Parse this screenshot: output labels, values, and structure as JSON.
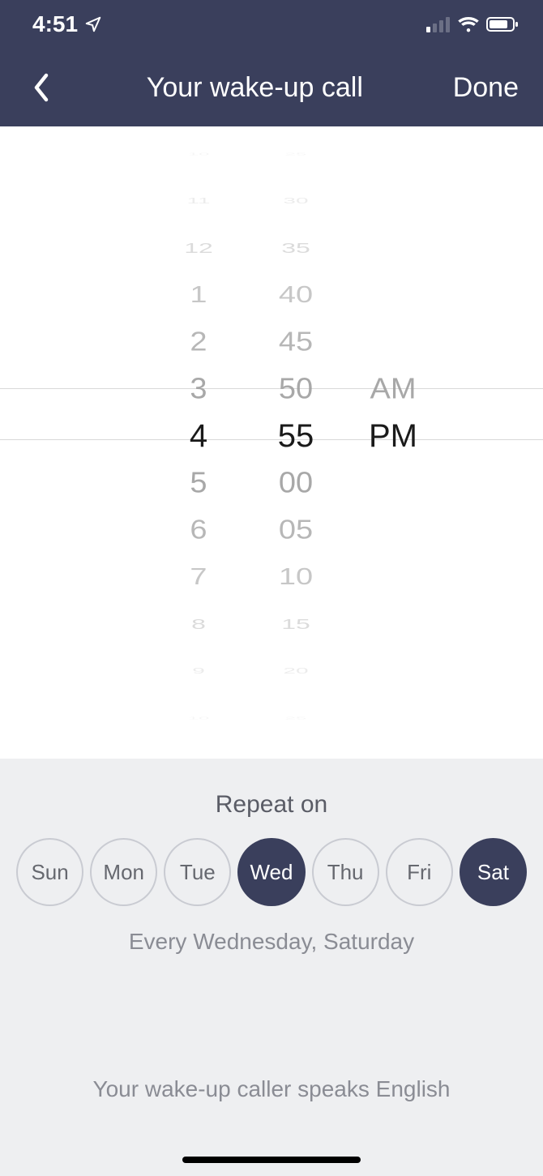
{
  "status": {
    "time": "4:51"
  },
  "nav": {
    "title": "Your wake-up call",
    "done": "Done"
  },
  "picker": {
    "hours": [
      "10",
      "11",
      "12",
      "1",
      "2",
      "3",
      "4",
      "5",
      "6",
      "7",
      "8",
      "9",
      "10"
    ],
    "minutes": [
      "25",
      "30",
      "35",
      "40",
      "45",
      "50",
      "55",
      "00",
      "05",
      "10",
      "15",
      "20",
      "25"
    ],
    "period_top": "AM",
    "period_sel": "PM",
    "selected_hour": "4",
    "selected_minute": "55",
    "selected_period": "PM"
  },
  "repeat": {
    "title": "Repeat on",
    "days": [
      {
        "label": "Sun",
        "on": false
      },
      {
        "label": "Mon",
        "on": false
      },
      {
        "label": "Tue",
        "on": false
      },
      {
        "label": "Wed",
        "on": true
      },
      {
        "label": "Thu",
        "on": false
      },
      {
        "label": "Fri",
        "on": false
      },
      {
        "label": "Sat",
        "on": true
      }
    ],
    "summary": "Every Wednesday, Saturday"
  },
  "caller": {
    "language_line": "Your wake-up caller speaks English"
  }
}
